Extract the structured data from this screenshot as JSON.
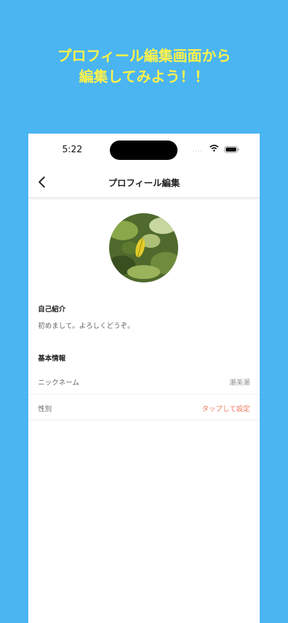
{
  "promo": {
    "line1": "プロフィール編集画面から",
    "line2": "編集してみよう！！"
  },
  "status_bar": {
    "time": "5:22",
    "signal": "····",
    "icons": [
      "wifi-icon",
      "battery-icon"
    ]
  },
  "nav": {
    "title": "プロフィール編集",
    "back_icon": "chevron-left-icon"
  },
  "profile": {
    "avatar_alt": "profile photo of a leaf"
  },
  "bio": {
    "heading": "自己紹介",
    "text": "初めまして。よろしくどうぞ。"
  },
  "basic_info": {
    "heading": "基本情報",
    "rows": [
      {
        "label": "ニックネーム",
        "value": "瀬美瀬",
        "value_color": "#999999"
      },
      {
        "label": "性別",
        "value": "タップして設定",
        "value_color": "#f07860"
      }
    ]
  },
  "colors": {
    "background": "#4bb5f2",
    "promo_text": "#fff24a",
    "accent": "#f07860"
  }
}
